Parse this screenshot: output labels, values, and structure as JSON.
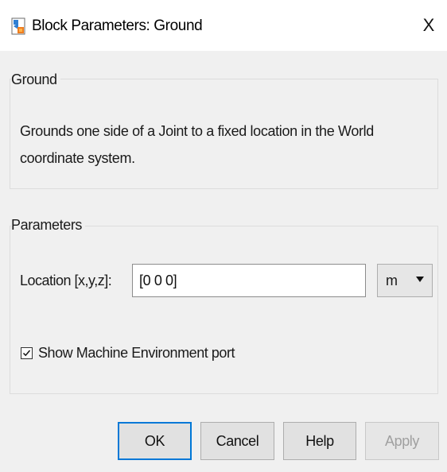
{
  "window": {
    "title": "Block Parameters: Ground",
    "close_glyph": "X",
    "icon": "simulink-block-icon"
  },
  "block_section": {
    "legend": "Ground",
    "description": "Grounds one side of a Joint to a fixed location in the World coordinate system."
  },
  "parameters_section": {
    "legend": "Parameters",
    "location": {
      "label": "Location [x,y,z]:",
      "value": "[0 0 0]"
    },
    "units": {
      "selected": "m"
    },
    "show_machine_env_port": {
      "label": "Show Machine Environment port",
      "checked": true
    }
  },
  "buttons": {
    "ok": "OK",
    "cancel": "Cancel",
    "help": "Help",
    "apply": "Apply"
  },
  "colors": {
    "focus_accent": "#0078d7",
    "dialog_bg": "#f0f0f0",
    "disabled_text": "#a0a0a0"
  }
}
